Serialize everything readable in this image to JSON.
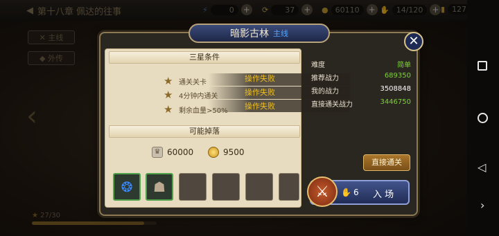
{
  "topbar": {
    "chapter": "第十八章 佩达的往事",
    "resources": [
      {
        "value": "0",
        "icon": "energy-icon"
      },
      {
        "value": "37",
        "icon": "refresh-icon"
      },
      {
        "value": "60110",
        "icon": "gold-coin-icon"
      },
      {
        "value": "14/120",
        "icon": "stamina-icon"
      },
      {
        "value": "127",
        "icon": "ticket-icon"
      }
    ]
  },
  "side_tabs": {
    "main": "主线",
    "side": "外传"
  },
  "bottom": {
    "stars": "27/30",
    "progress": 0.9
  },
  "dialog": {
    "title": "暗影古林",
    "subtitle": "主线",
    "three_star_header": "三星条件",
    "conditions": [
      {
        "label": "通关关卡",
        "status": "操作失败"
      },
      {
        "label": "4分钟内通关",
        "status": "操作失败"
      },
      {
        "label": "剩余血量>50%",
        "status": "操作失败"
      }
    ],
    "drops_header": "可能掉落",
    "rewards": [
      {
        "value": "60000",
        "icon": "crown-icon"
      },
      {
        "value": "9500",
        "icon": "gold-coin-icon"
      }
    ],
    "stats": [
      {
        "label": "难度",
        "value": "简单",
        "color": "#7fd13a"
      },
      {
        "label": "推荐战力",
        "value": "689350",
        "color": "#7fd13a"
      },
      {
        "label": "我的战力",
        "value": "3508848",
        "color": "#ffffff"
      },
      {
        "label": "直接通关战力",
        "value": "3446750",
        "color": "#7fd13a"
      }
    ],
    "direct_clear_button": "直接通关",
    "enter_cost": "6",
    "enter_button": "入 场"
  },
  "colors": {
    "accent_green": "#7fd13a",
    "fail_yellow": "#f0c020",
    "title_blue": "#4fa6ff"
  }
}
